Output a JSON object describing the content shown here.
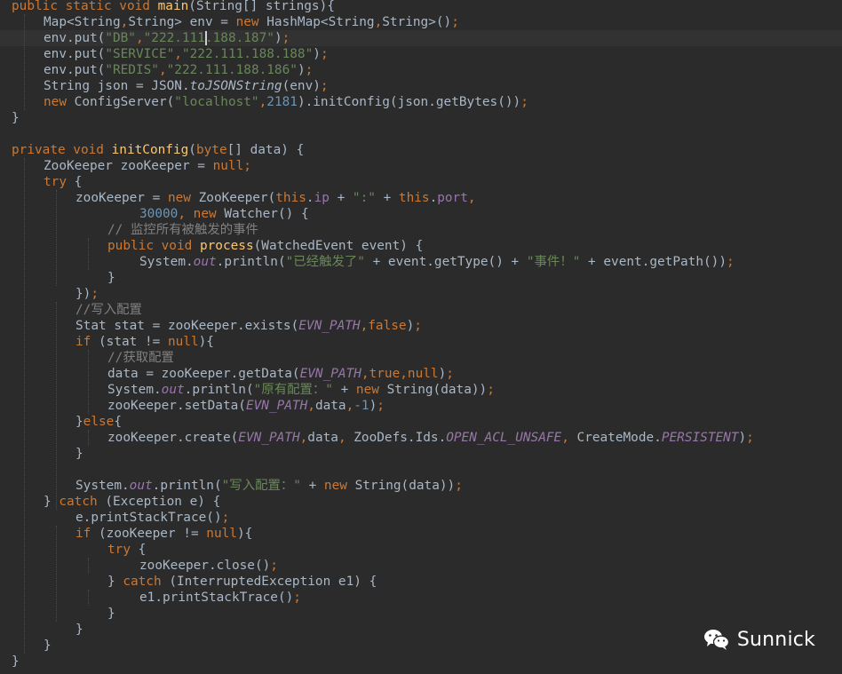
{
  "editor": {
    "current_line_index": 2,
    "caret_after_token": "2.3",
    "lines": [
      {
        "indent": 0,
        "tokens": [
          [
            "kw",
            "public static void "
          ],
          [
            "fn",
            "main"
          ],
          [
            "pl",
            "(String[] strings){"
          ]
        ]
      },
      {
        "indent": 1,
        "tokens": [
          [
            "pl",
            "Map<String"
          ],
          [
            "kw",
            ","
          ],
          [
            "pl",
            "String> env = "
          ],
          [
            "kw",
            "new "
          ],
          [
            "pl",
            "HashMap<String"
          ],
          [
            "kw",
            ","
          ],
          [
            "pl",
            "String>()"
          ],
          [
            "kw",
            ";"
          ]
        ]
      },
      {
        "indent": 1,
        "tokens": [
          [
            "pl",
            "env.put("
          ],
          [
            "str",
            "\"DB\""
          ],
          [
            "kw",
            ","
          ],
          [
            "str",
            "\"222.111"
          ],
          [
            "str",
            ".188.187\""
          ],
          [
            "pl",
            ")"
          ],
          [
            "kw",
            ";"
          ]
        ]
      },
      {
        "indent": 1,
        "tokens": [
          [
            "pl",
            "env.put("
          ],
          [
            "str",
            "\"SERVICE\""
          ],
          [
            "kw",
            ","
          ],
          [
            "str",
            "\"222.111.188.188\""
          ],
          [
            "pl",
            ")"
          ],
          [
            "kw",
            ";"
          ]
        ]
      },
      {
        "indent": 1,
        "tokens": [
          [
            "pl",
            "env.put("
          ],
          [
            "str",
            "\"REDIS\""
          ],
          [
            "kw",
            ","
          ],
          [
            "str",
            "\"222.111.188.186\""
          ],
          [
            "pl",
            ")"
          ],
          [
            "kw",
            ";"
          ]
        ]
      },
      {
        "indent": 1,
        "tokens": [
          [
            "pl",
            "String json = JSON."
          ],
          [
            "stm",
            "toJSONString"
          ],
          [
            "pl",
            "(env)"
          ],
          [
            "kw",
            ";"
          ]
        ]
      },
      {
        "indent": 1,
        "tokens": [
          [
            "kw",
            "new "
          ],
          [
            "pl",
            "ConfigServer("
          ],
          [
            "str",
            "\"localhost\""
          ],
          [
            "kw",
            ","
          ],
          [
            "num",
            "2181"
          ],
          [
            "pl",
            ").initConfig(json.getBytes())"
          ],
          [
            "kw",
            ";"
          ]
        ]
      },
      {
        "indent": 0,
        "tokens": [
          [
            "pl",
            "}"
          ]
        ]
      },
      {
        "indent": 0,
        "tokens": []
      },
      {
        "indent": 0,
        "tokens": [
          [
            "kw",
            "private void "
          ],
          [
            "fn",
            "initConfig"
          ],
          [
            "pl",
            "("
          ],
          [
            "kw",
            "byte"
          ],
          [
            "pl",
            "[] data) {"
          ]
        ]
      },
      {
        "indent": 1,
        "tokens": [
          [
            "pl",
            "ZooKeeper zooKeeper = "
          ],
          [
            "kw",
            "null;"
          ]
        ]
      },
      {
        "indent": 1,
        "tokens": [
          [
            "kw",
            "try "
          ],
          [
            "pl",
            "{"
          ]
        ]
      },
      {
        "indent": 2,
        "tokens": [
          [
            "pl",
            "zooKeeper = "
          ],
          [
            "kw",
            "new "
          ],
          [
            "pl",
            "ZooKeeper("
          ],
          [
            "kw",
            "this"
          ],
          [
            "pl",
            "."
          ],
          [
            "fld",
            "ip "
          ],
          [
            "pl",
            "+ "
          ],
          [
            "str",
            "\":\" "
          ],
          [
            "pl",
            "+ "
          ],
          [
            "kw",
            "this"
          ],
          [
            "pl",
            "."
          ],
          [
            "fld",
            "port"
          ],
          [
            "kw",
            ","
          ]
        ]
      },
      {
        "indent": 4,
        "tokens": [
          [
            "num",
            "30000"
          ],
          [
            "kw",
            ", new "
          ],
          [
            "pl",
            "Watcher() {"
          ]
        ]
      },
      {
        "indent": 3,
        "tokens": [
          [
            "cmt",
            "// 监控所有被触发的事件"
          ]
        ]
      },
      {
        "indent": 3,
        "tokens": [
          [
            "kw",
            "public void "
          ],
          [
            "fn",
            "process"
          ],
          [
            "pl",
            "(WatchedEvent event) {"
          ]
        ]
      },
      {
        "indent": 4,
        "tokens": [
          [
            "pl",
            "System."
          ],
          [
            "sit",
            "out"
          ],
          [
            "pl",
            ".println("
          ],
          [
            "str",
            "\"已经触发了\" "
          ],
          [
            "pl",
            "+ event.getType() + "
          ],
          [
            "str",
            "\"事件！\" "
          ],
          [
            "pl",
            "+ event.getPath())"
          ],
          [
            "kw",
            ";"
          ]
        ]
      },
      {
        "indent": 3,
        "tokens": [
          [
            "pl",
            "}"
          ]
        ]
      },
      {
        "indent": 2,
        "tokens": [
          [
            "pl",
            "})"
          ],
          [
            "kw",
            ";"
          ]
        ]
      },
      {
        "indent": 2,
        "tokens": [
          [
            "cmt",
            "//写入配置"
          ]
        ]
      },
      {
        "indent": 2,
        "tokens": [
          [
            "pl",
            "Stat stat = zooKeeper.exists("
          ],
          [
            "sit",
            "EVN_PATH"
          ],
          [
            "kw",
            ",false"
          ],
          [
            "pl",
            ")"
          ],
          [
            "kw",
            ";"
          ]
        ]
      },
      {
        "indent": 2,
        "tokens": [
          [
            "kw",
            "if "
          ],
          [
            "pl",
            "(stat != "
          ],
          [
            "kw",
            "null"
          ],
          [
            "pl",
            "){"
          ]
        ]
      },
      {
        "indent": 3,
        "tokens": [
          [
            "cmt",
            "//获取配置"
          ]
        ]
      },
      {
        "indent": 3,
        "tokens": [
          [
            "pl",
            "data = zooKeeper.getData("
          ],
          [
            "sit",
            "EVN_PATH"
          ],
          [
            "kw",
            ",true,null"
          ],
          [
            "pl",
            ")"
          ],
          [
            "kw",
            ";"
          ]
        ]
      },
      {
        "indent": 3,
        "tokens": [
          [
            "pl",
            "System."
          ],
          [
            "sit",
            "out"
          ],
          [
            "pl",
            ".println("
          ],
          [
            "str",
            "\"原有配置：\" "
          ],
          [
            "pl",
            "+ "
          ],
          [
            "kw",
            "new "
          ],
          [
            "pl",
            "String(data))"
          ],
          [
            "kw",
            ";"
          ]
        ]
      },
      {
        "indent": 3,
        "tokens": [
          [
            "pl",
            "zooKeeper.setData("
          ],
          [
            "sit",
            "EVN_PATH"
          ],
          [
            "kw",
            ","
          ],
          [
            "pl",
            "data"
          ],
          [
            "kw",
            ","
          ],
          [
            "num",
            "-1"
          ],
          [
            "pl",
            ")"
          ],
          [
            "kw",
            ";"
          ]
        ]
      },
      {
        "indent": 2,
        "tokens": [
          [
            "pl",
            "}"
          ],
          [
            "kw",
            "else"
          ],
          [
            "pl",
            "{"
          ]
        ]
      },
      {
        "indent": 3,
        "tokens": [
          [
            "pl",
            "zooKeeper.create("
          ],
          [
            "sit",
            "EVN_PATH"
          ],
          [
            "kw",
            ","
          ],
          [
            "pl",
            "data"
          ],
          [
            "kw",
            ", "
          ],
          [
            "pl",
            "ZooDefs.Ids."
          ],
          [
            "sit",
            "OPEN_ACL_UNSAFE"
          ],
          [
            "kw",
            ", "
          ],
          [
            "pl",
            "CreateMode."
          ],
          [
            "sit",
            "PERSISTENT"
          ],
          [
            "pl",
            ")"
          ],
          [
            "kw",
            ";"
          ]
        ]
      },
      {
        "indent": 2,
        "tokens": [
          [
            "pl",
            "}"
          ]
        ]
      },
      {
        "indent": 0,
        "tokens": []
      },
      {
        "indent": 2,
        "tokens": [
          [
            "pl",
            "System."
          ],
          [
            "sit",
            "out"
          ],
          [
            "pl",
            ".println("
          ],
          [
            "str",
            "\"写入配置：\" "
          ],
          [
            "pl",
            "+ "
          ],
          [
            "kw",
            "new "
          ],
          [
            "pl",
            "String(data))"
          ],
          [
            "kw",
            ";"
          ]
        ]
      },
      {
        "indent": 1,
        "tokens": [
          [
            "pl",
            "} "
          ],
          [
            "kw",
            "catch "
          ],
          [
            "pl",
            "(Exception e) {"
          ]
        ]
      },
      {
        "indent": 2,
        "tokens": [
          [
            "pl",
            "e.printStackTrace()"
          ],
          [
            "kw",
            ";"
          ]
        ]
      },
      {
        "indent": 2,
        "tokens": [
          [
            "kw",
            "if "
          ],
          [
            "pl",
            "(zooKeeper != "
          ],
          [
            "kw",
            "null"
          ],
          [
            "pl",
            "){"
          ]
        ]
      },
      {
        "indent": 3,
        "tokens": [
          [
            "kw",
            "try "
          ],
          [
            "pl",
            "{"
          ]
        ]
      },
      {
        "indent": 4,
        "tokens": [
          [
            "pl",
            "zooKeeper.close()"
          ],
          [
            "kw",
            ";"
          ]
        ]
      },
      {
        "indent": 3,
        "tokens": [
          [
            "pl",
            "} "
          ],
          [
            "kw",
            "catch "
          ],
          [
            "pl",
            "(InterruptedException e1) {"
          ]
        ]
      },
      {
        "indent": 4,
        "tokens": [
          [
            "pl",
            "e1.printStackTrace()"
          ],
          [
            "kw",
            ";"
          ]
        ]
      },
      {
        "indent": 3,
        "tokens": [
          [
            "pl",
            "}"
          ]
        ]
      },
      {
        "indent": 2,
        "tokens": [
          [
            "pl",
            "}"
          ]
        ]
      },
      {
        "indent": 1,
        "tokens": [
          [
            "pl",
            "}"
          ]
        ]
      },
      {
        "indent": 0,
        "tokens": [
          [
            "pl",
            "}"
          ]
        ]
      }
    ]
  },
  "watermark": {
    "text": "Sunnick",
    "icon": "wechat-icon"
  },
  "colors": {
    "background": "#2b2b2b",
    "keyword": "#cc7832",
    "method": "#ffc66d",
    "string": "#6a8759",
    "number": "#6897bb",
    "field": "#9876aa",
    "comment": "#808080",
    "plain": "#a9b7c6"
  }
}
